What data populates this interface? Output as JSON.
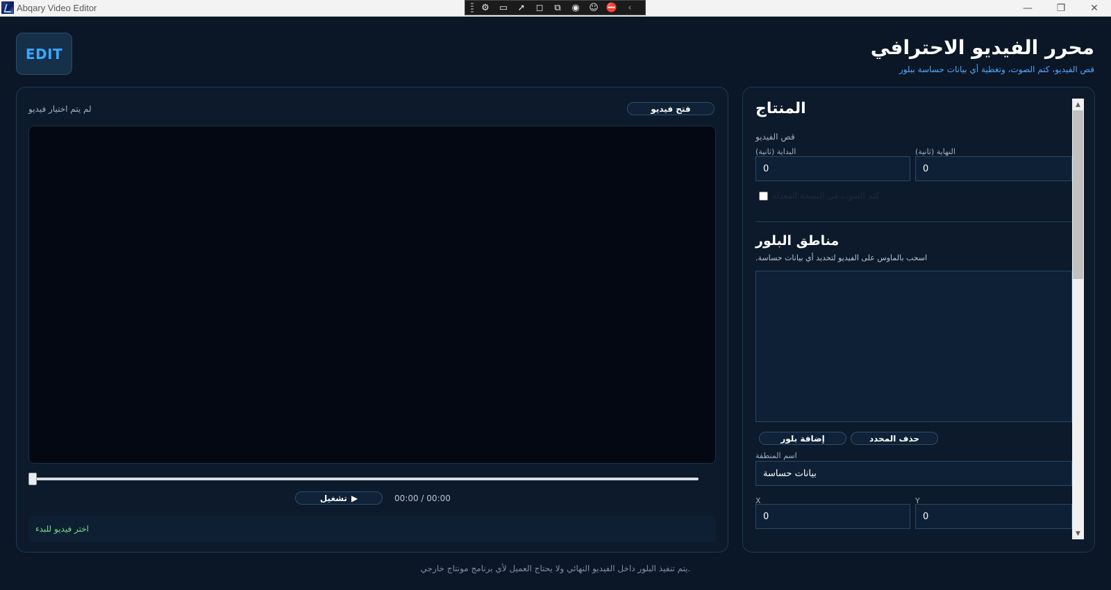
{
  "window": {
    "title": "Abqary Video Editor",
    "controls": {
      "minimize": "—",
      "maximize": "❐",
      "close": "✕"
    },
    "capture_toolbar_icons": [
      "settings-icon",
      "video-icon",
      "pointer-icon",
      "region-icon",
      "window-capture-icon",
      "audio-icon",
      "accessibility-icon",
      "stop-icon",
      "chevron-left-icon"
    ]
  },
  "header": {
    "logo_text": "EDIT",
    "title": "محرر الفيديو الاحترافي",
    "subtitle": "قص الفيديو، كتم الصوت، وتغطية أي بيانات حساسة ببلور"
  },
  "player": {
    "open_button": "فتح فيديو",
    "file_status": "لم يتم اختيار فيديو",
    "play_icon": "▶",
    "play_button": "تشغيل",
    "time_readout": "00:00 / 00:00",
    "seek_progress": 0,
    "status_message": "اختر فيديو للبدء"
  },
  "editor": {
    "title": "المنتاج",
    "trim_label": "قص الفيديو",
    "start_label": "البداية (ثانية)",
    "end_label": "النهاية (ثانية)",
    "start_value": "0",
    "end_value": "0",
    "mute_label": "كتم الصوت في النسخة المعدلة",
    "mute_checked": false,
    "blur_title": "مناطق البلور",
    "blur_hint": "اسحب بالماوس على الفيديو لتحديد أي بيانات حساسة.",
    "delete_button": "حذف المحدد",
    "add_button": "إضافة بلور",
    "region_name_label": "اسم المنطقة",
    "region_name_value": "بيانات حساسة",
    "x_label": "X",
    "y_label": "Y",
    "x_value": "0",
    "y_value": "0"
  },
  "footer": {
    "note": "يتم تنفيذ البلور داخل الفيديو النهائي ولا يحتاج العميل لأي برنامج مونتاج خارجي."
  },
  "colors": {
    "background": "#0b1626",
    "panel": "#0c1a2b",
    "accent": "#3aa7ff",
    "subtitle": "#4ea9ff",
    "status_green": "#6fe08a"
  }
}
